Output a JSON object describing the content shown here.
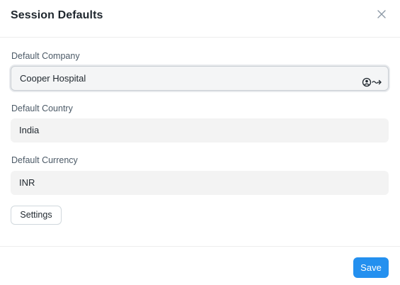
{
  "modal": {
    "title": "Session Defaults"
  },
  "fields": {
    "company": {
      "label": "Default Company",
      "value": "Cooper Hospital"
    },
    "country": {
      "label": "Default Country",
      "value": "India"
    },
    "currency": {
      "label": "Default Currency",
      "value": "INR"
    }
  },
  "buttons": {
    "settings_label": "Settings",
    "save_label": "Save"
  },
  "icons": {
    "close": "close-icon",
    "link": "link-arrow-icon"
  },
  "colors": {
    "primary": "#2490ef",
    "field_bg": "#f3f3f3",
    "text": "#1f272e",
    "label": "#4c5a67"
  }
}
